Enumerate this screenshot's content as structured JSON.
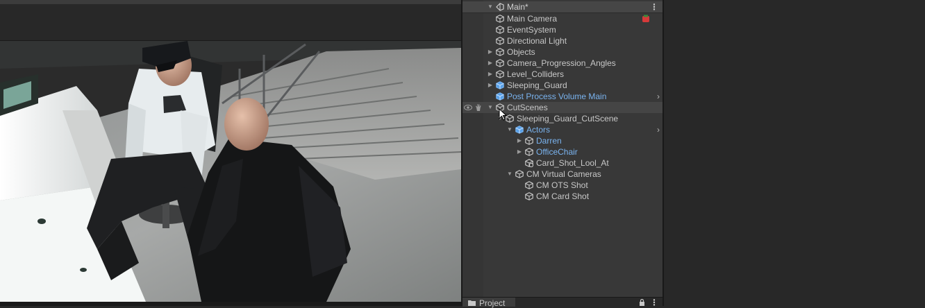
{
  "hierarchy": {
    "scene_name": "Main*",
    "items": [
      {
        "label": "Main Camera",
        "name": "main-camera",
        "depth": 1,
        "expandable": false,
        "expanded": false,
        "prefab": false
      },
      {
        "label": "EventSystem",
        "name": "event-system",
        "depth": 1,
        "expandable": false,
        "expanded": false,
        "prefab": false
      },
      {
        "label": "Directional Light",
        "name": "directional-light",
        "depth": 1,
        "expandable": false,
        "expanded": false,
        "prefab": false
      },
      {
        "label": "Objects",
        "name": "objects",
        "depth": 1,
        "expandable": true,
        "expanded": false,
        "prefab": false
      },
      {
        "label": "Camera_Progression_Angles",
        "name": "camera-progression-angles",
        "depth": 1,
        "expandable": true,
        "expanded": false,
        "prefab": false
      },
      {
        "label": "Level_Colliders",
        "name": "level-colliders",
        "depth": 1,
        "expandable": true,
        "expanded": false,
        "prefab": false
      },
      {
        "label": "Sleeping_Guard",
        "name": "sleeping-guard",
        "depth": 1,
        "expandable": true,
        "expanded": false,
        "prefab": true,
        "prefab_label": false
      },
      {
        "label": "Post Process Volume Main",
        "name": "post-process-volume-main",
        "depth": 1,
        "expandable": false,
        "expanded": false,
        "prefab": true,
        "chevron": true
      },
      {
        "label": "CutScenes",
        "name": "cutscenes",
        "depth": 1,
        "expandable": true,
        "expanded": true,
        "prefab": false,
        "hover": true
      },
      {
        "label": "Sleeping_Guard_CutScene",
        "name": "sleeping-guard-cutscene",
        "depth": 2,
        "expandable": true,
        "expanded": true,
        "prefab": false
      },
      {
        "label": "Actors",
        "name": "actors",
        "depth": 3,
        "expandable": true,
        "expanded": true,
        "prefab": true,
        "chevron": true
      },
      {
        "label": "Darren",
        "name": "darren",
        "depth": 4,
        "expandable": true,
        "expanded": false,
        "prefab": true,
        "prefab_outline": true
      },
      {
        "label": "OfficeChair",
        "name": "office-chair",
        "depth": 4,
        "expandable": true,
        "expanded": false,
        "prefab": true,
        "prefab_outline": true
      },
      {
        "label": "Card_Shot_Lool_At",
        "name": "card-shot-lool-at",
        "depth": 4,
        "expandable": false,
        "expanded": false,
        "prefab": false,
        "special_icon": true
      },
      {
        "label": "CM Virtual Cameras",
        "name": "cm-virtual-cameras",
        "depth": 3,
        "expandable": true,
        "expanded": true,
        "prefab": false
      },
      {
        "label": "CM OTS Shot",
        "name": "cm-ots-shot",
        "depth": 4,
        "expandable": false,
        "expanded": false,
        "prefab": false
      },
      {
        "label": "CM Card Shot",
        "name": "cm-card-shot",
        "depth": 4,
        "expandable": false,
        "expanded": false,
        "prefab": false
      }
    ]
  },
  "project_tab": {
    "label": "Project"
  },
  "icons": {
    "scene": "unity-scene-icon",
    "gameobject": "cube-icon",
    "prefab": "prefab-cube-icon",
    "error": "error-icon",
    "visibility": "eye-icon",
    "pickability": "hand-icon",
    "lock": "lock-icon",
    "folder": "folder-icon"
  },
  "colors": {
    "prefab_text": "#7ab4f0",
    "text": "#c8c8c8",
    "panel_bg": "#383838",
    "error_red": "#d63a3a"
  }
}
